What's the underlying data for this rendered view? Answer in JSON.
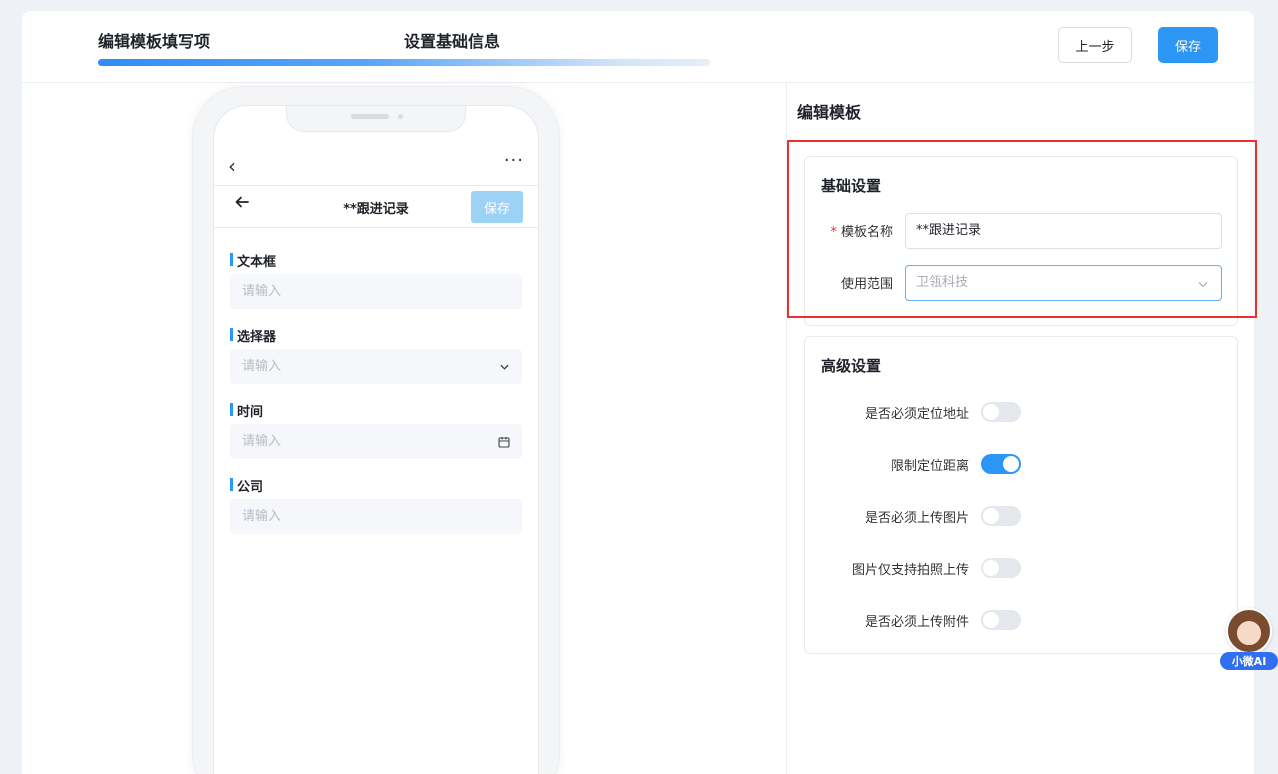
{
  "header": {
    "step1": "编辑模板填写项",
    "step2": "设置基础信息",
    "prev_button": "上一步",
    "save_button": "保存"
  },
  "phone": {
    "nav_back": "‹",
    "nav_more": "···",
    "title": "**跟进记录",
    "save_button": "保存",
    "fields": [
      {
        "label": "文本框",
        "placeholder": "请输入"
      },
      {
        "label": "选择器",
        "placeholder": "请输入"
      },
      {
        "label": "时间",
        "placeholder": "请输入"
      },
      {
        "label": "公司",
        "placeholder": "请输入"
      }
    ]
  },
  "panel": {
    "title": "编辑模板",
    "basic": {
      "title": "基础设置",
      "name_label": "模板名称",
      "name_required": "*",
      "name_value": "**跟进记录",
      "scope_label": "使用范围",
      "scope_value": "卫瓴科技"
    },
    "advanced": {
      "title": "高级设置",
      "switches": [
        {
          "label": "是否必须定位地址",
          "on": false
        },
        {
          "label": "限制定位距离",
          "on": true
        },
        {
          "label": "是否必须上传图片",
          "on": false
        },
        {
          "label": "图片仅支持拍照上传",
          "on": false
        },
        {
          "label": "是否必须上传附件",
          "on": false
        }
      ]
    }
  },
  "ai_badge": "小微AI",
  "colors": {
    "accent": "#2b96f3",
    "highlight_frame": "#e8322b"
  }
}
